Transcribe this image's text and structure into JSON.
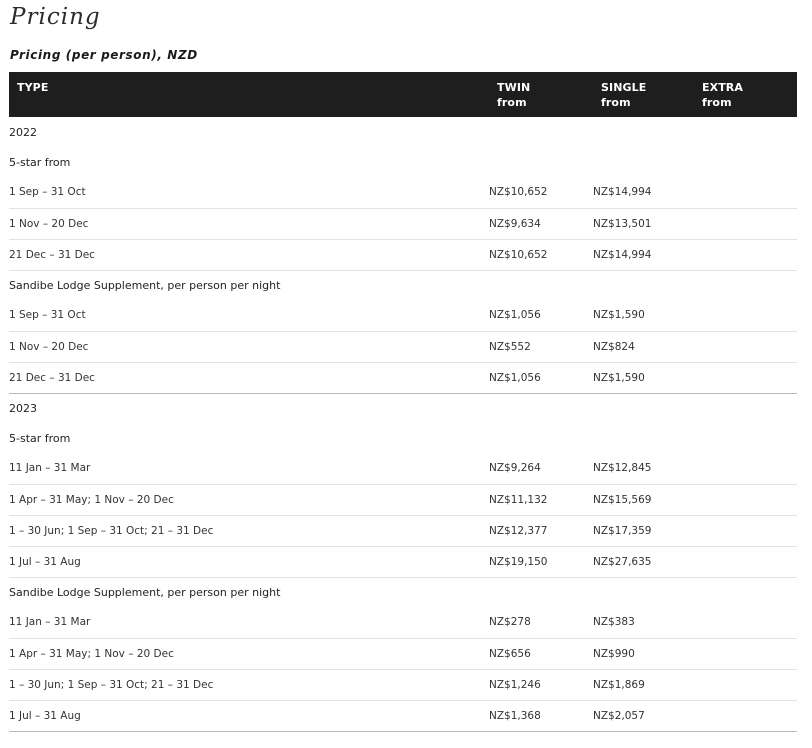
{
  "page_title": "Pricing",
  "subtitle": "Pricing (per person), NZD",
  "headers": {
    "type": "TYPE",
    "twin": [
      "TWIN",
      "from"
    ],
    "single": [
      "SINGLE",
      "from"
    ],
    "extra": [
      "EXTRA",
      "from"
    ]
  },
  "years": [
    {
      "year": "2022",
      "groups": [
        {
          "name": "5-star from",
          "rows": [
            {
              "type": "1 Sep – 31 Oct",
              "twin": "NZ$10,652",
              "single": "NZ$14,994",
              "extra": ""
            },
            {
              "type": "1 Nov – 20 Dec",
              "twin": "NZ$9,634",
              "single": "NZ$13,501",
              "extra": ""
            },
            {
              "type": "21 Dec – 31 Dec",
              "twin": "NZ$10,652",
              "single": "NZ$14,994",
              "extra": ""
            }
          ]
        },
        {
          "name": "Sandibe Lodge Supplement, per person per night",
          "rows": [
            {
              "type": "1 Sep – 31 Oct",
              "twin": "NZ$1,056",
              "single": "NZ$1,590",
              "extra": ""
            },
            {
              "type": "1 Nov – 20 Dec",
              "twin": "NZ$552",
              "single": "NZ$824",
              "extra": ""
            },
            {
              "type": "21 Dec – 31 Dec",
              "twin": "NZ$1,056",
              "single": "NZ$1,590",
              "extra": ""
            }
          ]
        }
      ]
    },
    {
      "year": "2023",
      "groups": [
        {
          "name": "5-star from",
          "rows": [
            {
              "type": "11 Jan – 31 Mar",
              "twin": "NZ$9,264",
              "single": "NZ$12,845",
              "extra": ""
            },
            {
              "type": "1 Apr – 31 May; 1 Nov – 20 Dec",
              "twin": "NZ$11,132",
              "single": "NZ$15,569",
              "extra": ""
            },
            {
              "type": "1 – 30 Jun; 1 Sep – 31 Oct; 21 – 31 Dec",
              "twin": "NZ$12,377",
              "single": "NZ$17,359",
              "extra": ""
            },
            {
              "type": "1 Jul – 31 Aug",
              "twin": "NZ$19,150",
              "single": "NZ$27,635",
              "extra": ""
            }
          ]
        },
        {
          "name": "Sandibe Lodge Supplement, per person per night",
          "rows": [
            {
              "type": "11 Jan – 31 Mar",
              "twin": "NZ$278",
              "single": "NZ$383",
              "extra": ""
            },
            {
              "type": "1 Apr – 31 May; 1 Nov – 20 Dec",
              "twin": "NZ$656",
              "single": "NZ$990",
              "extra": ""
            },
            {
              "type": "1 – 30 Jun; 1 Sep – 31 Oct; 21 – 31 Dec",
              "twin": "NZ$1,246",
              "single": "NZ$1,869",
              "extra": ""
            },
            {
              "type": "1 Jul – 31 Aug",
              "twin": "NZ$1,368",
              "single": "NZ$2,057",
              "extra": ""
            }
          ]
        }
      ]
    }
  ]
}
